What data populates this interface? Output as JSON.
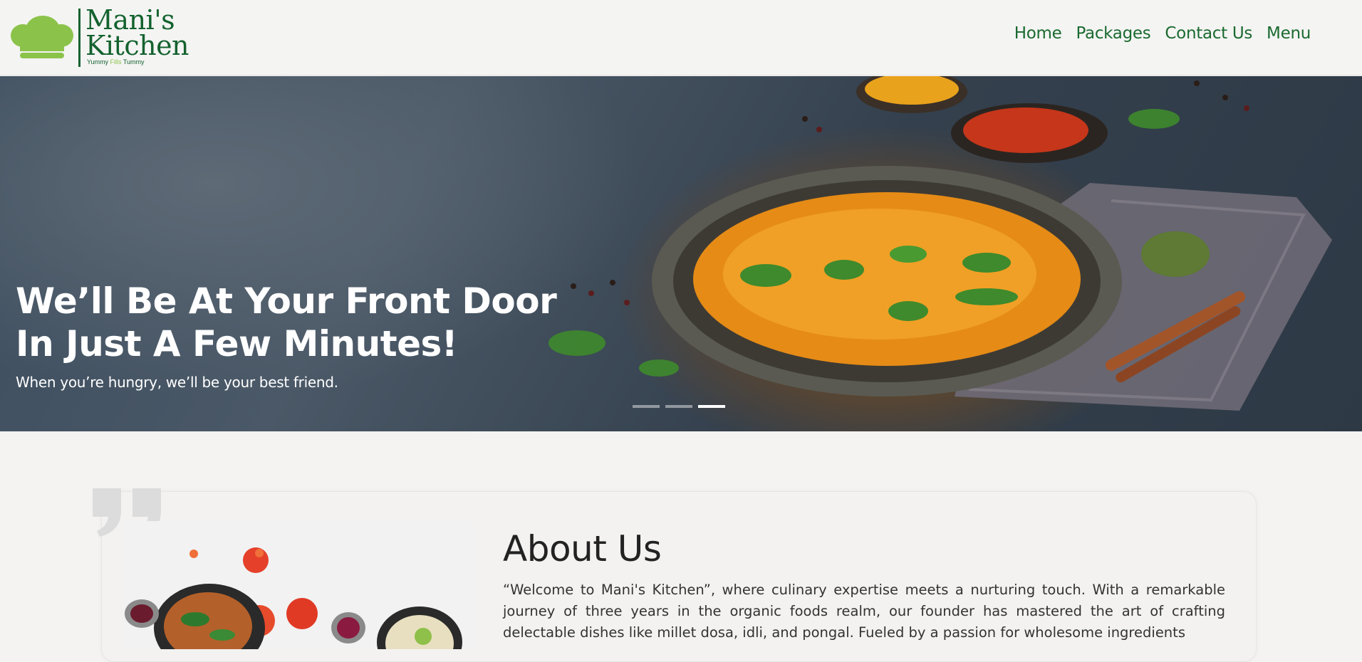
{
  "brand": {
    "name_line1": "Mani's",
    "name_line2": "Kitchen",
    "tagline_part1": "Yummy",
    "tagline_part2": "Fills",
    "tagline_part3": "Tummy",
    "logo_icon": "chef-hat-icon",
    "primary_color": "#14622e",
    "accent_color": "#8bc34a"
  },
  "nav": {
    "items": [
      {
        "label": "Home"
      },
      {
        "label": "Packages"
      },
      {
        "label": "Contact Us"
      },
      {
        "label": "Menu"
      }
    ]
  },
  "hero": {
    "title_line1": "We’ll Be At Your Front Door",
    "title_line2": "In Just A Few Minutes!",
    "subtitle": "When you’re hungry, we’ll be your best friend.",
    "slide_count": 3,
    "active_slide": 3
  },
  "about": {
    "title": "About Us",
    "text": "“Welcome to Mani's Kitchen”, where culinary expertise meets a nurturing touch. With a remarkable journey of three years in the organic foods realm, our founder has mastered the art of crafting delectable dishes like millet dosa, idli, and pongal. Fueled by a passion for wholesome ingredients",
    "quote_icon": "quote-icon"
  }
}
